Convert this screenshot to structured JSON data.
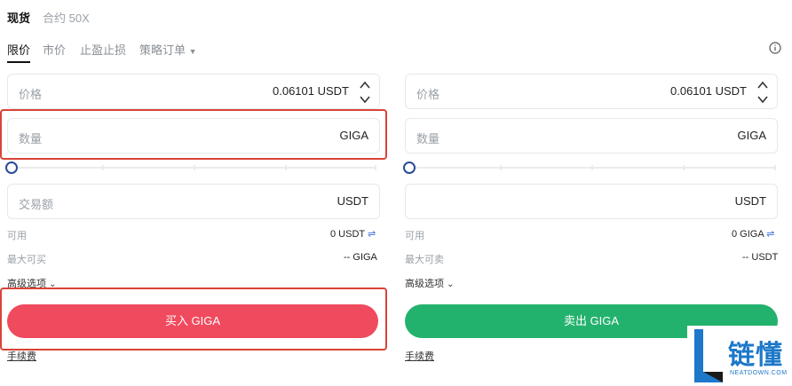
{
  "top_tabs": [
    "现货",
    "合约 50X"
  ],
  "sub_tabs": [
    "限价",
    "市价",
    "止盈止损",
    "策略订单"
  ],
  "info_icon": "info-icon",
  "buy": {
    "price_label": "价格",
    "price_value": "0.06101 USDT",
    "qty_label": "数量",
    "qty_unit": "GIGA",
    "amount_label": "交易额",
    "amount_unit": "USDT",
    "avail_label": "可用",
    "avail_value": "0 USDT",
    "max_label": "最大可买",
    "max_value": "-- GIGA",
    "advanced_label": "高级选项",
    "button_label": "买入 GIGA",
    "fee_label": "手续费",
    "color": "#ef4a5e"
  },
  "sell": {
    "price_label": "价格",
    "price_value": "0.06101 USDT",
    "qty_label": "数量",
    "qty_unit": "GIGA",
    "amount_label": "",
    "amount_unit": "USDT",
    "avail_label": "可用",
    "avail_value": "0 GIGA",
    "max_label": "最大可卖",
    "max_value": "-- USDT",
    "advanced_label": "高级选项",
    "button_label": "卖出 GIGA",
    "fee_label": "手续费",
    "color": "#23b26d"
  },
  "watermark": {
    "brand": "链懂",
    "domain": "NEATDOWN.COM"
  }
}
